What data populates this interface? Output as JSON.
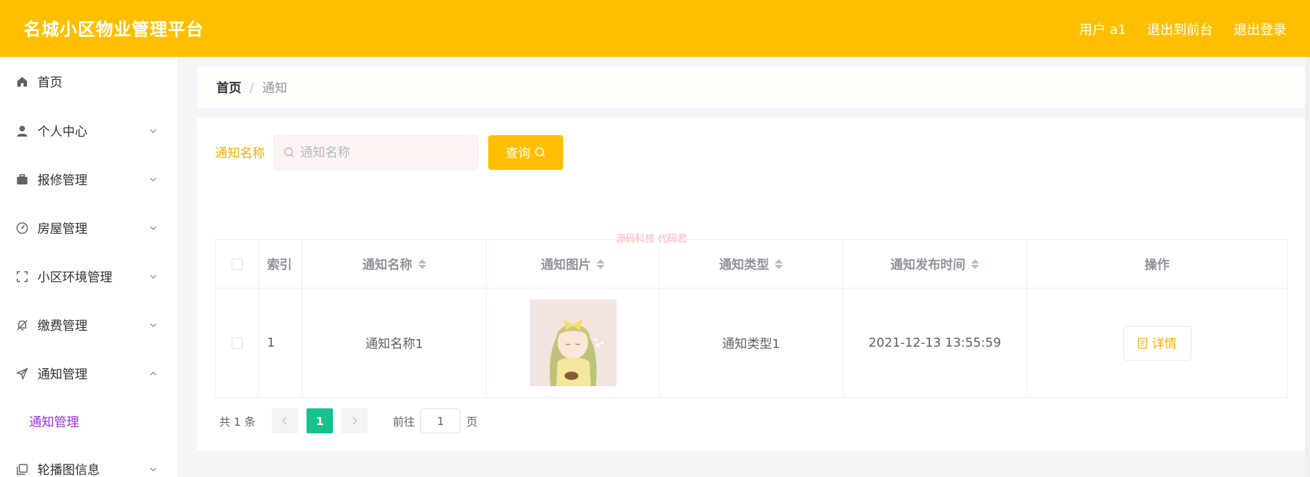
{
  "header": {
    "title": "名城小区物业管理平台",
    "user": "用户 a1",
    "to_front": "退出到前台",
    "logout": "退出登录"
  },
  "sidebar": {
    "items": [
      {
        "label": "首页",
        "icon": "home-icon"
      },
      {
        "label": "个人中心",
        "icon": "user-icon"
      },
      {
        "label": "报修管理",
        "icon": "briefcase-icon"
      },
      {
        "label": "房屋管理",
        "icon": "gauge-icon"
      },
      {
        "label": "小区环境管理",
        "icon": "frame-icon"
      },
      {
        "label": "缴费管理",
        "icon": "bell-off-icon"
      },
      {
        "label": "通知管理",
        "icon": "send-icon"
      },
      {
        "label": "轮播图信息",
        "icon": "copy-icon"
      }
    ],
    "active_sub": "通知管理"
  },
  "breadcrumb": {
    "home": "首页",
    "separator": "/",
    "current": "通知"
  },
  "search": {
    "label": "通知名称",
    "placeholder": "通知名称",
    "button": "查询"
  },
  "watermark": "源码科技 代码君",
  "table": {
    "columns": [
      "索引",
      "通知名称",
      "通知图片",
      "通知类型",
      "通知发布时间",
      "操作"
    ],
    "rows": [
      {
        "index": "1",
        "name": "通知名称1",
        "image": "anime-girl-thumbnail",
        "type": "通知类型1",
        "time": "2021-12-13 13:55:59",
        "action": "详情"
      }
    ]
  },
  "pagination": {
    "total": "共 1 条",
    "current_page": "1",
    "goto_label": "前往",
    "goto_value": "1",
    "suffix": "页"
  },
  "colors": {
    "accent": "#ffbf00",
    "active_sub": "#9b2fd6",
    "page_active": "#13c28d"
  }
}
